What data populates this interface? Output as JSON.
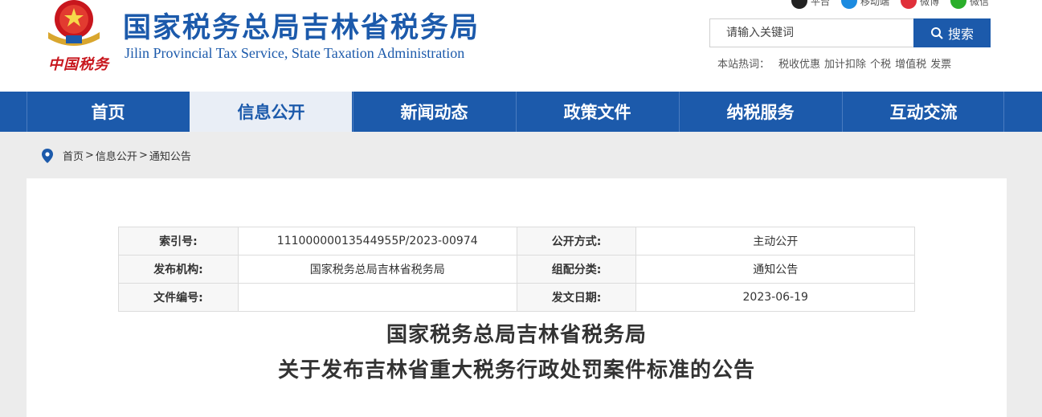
{
  "header": {
    "title": "国家税务总局吉林省税务局",
    "title_en": "Jilin Provincial Tax Service, State Taxation Administration",
    "logo_text": "中国税务",
    "topbar": [
      {
        "label": "平台",
        "color": "#222222",
        "icon": "platform-icon"
      },
      {
        "label": "移动端",
        "color": "#1c8be0",
        "icon": "mobile-icon"
      },
      {
        "label": "微博",
        "color": "#e0303a",
        "icon": "weibo-icon"
      },
      {
        "label": "微信",
        "color": "#2aae2a",
        "icon": "wechat-icon"
      }
    ],
    "search": {
      "placeholder": "请输入关键词",
      "button_label": "搜索"
    },
    "hot": {
      "label": "本站热词：",
      "terms": [
        "税收优惠",
        "加计扣除",
        "个税",
        "增值税",
        "发票"
      ]
    }
  },
  "nav": {
    "items": [
      "首页",
      "信息公开",
      "新闻动态",
      "政策文件",
      "纳税服务",
      "互动交流"
    ],
    "active_index": 1
  },
  "breadcrumb": {
    "items": [
      "首页",
      "信息公开",
      "通知公告"
    ],
    "separator": ">"
  },
  "meta": {
    "rows": [
      [
        {
          "k": "索引号:",
          "v": "11100000013544955P/2023-00974"
        },
        {
          "k": "公开方式:",
          "v": "主动公开"
        }
      ],
      [
        {
          "k": "发布机构:",
          "v": "国家税务总局吉林省税务局"
        },
        {
          "k": "组配分类:",
          "v": "通知公告"
        }
      ],
      [
        {
          "k": "文件编号:",
          "v": ""
        },
        {
          "k": "发文日期:",
          "v": "2023-06-19"
        }
      ]
    ]
  },
  "document": {
    "title_line1": "国家税务总局吉林省税务局",
    "title_line2": "关于发布吉林省重大税务行政处罚案件标准的公告"
  },
  "colors": {
    "brand_blue": "#1c5aab",
    "brand_red": "#c8161d",
    "nav_active_bg": "#e9eef6"
  }
}
